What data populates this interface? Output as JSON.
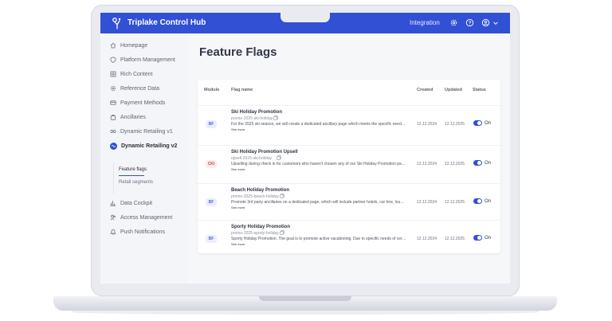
{
  "header": {
    "app_title": "Triplake Control Hub",
    "integration_label": "Integration",
    "icons": [
      "logo-icon",
      "gear-icon",
      "help-icon",
      "user-icon",
      "chevron-down-icon"
    ],
    "brand_color": "#3150d4"
  },
  "sidebar": {
    "items": [
      {
        "label": "Homepage",
        "icon": "home-icon"
      },
      {
        "label": "Platform Management",
        "icon": "shield-icon"
      },
      {
        "label": "Rich Content",
        "icon": "grid-icon"
      },
      {
        "label": "Reference Data",
        "icon": "settings-icon"
      },
      {
        "label": "Payment Methods",
        "icon": "credit-card-icon"
      },
      {
        "label": "Ancillaries",
        "icon": "bag-icon"
      },
      {
        "label": "Dynamic Retailing v1",
        "icon": "loop-icon"
      },
      {
        "label": "Dynamic Retailing v2",
        "icon": "active-dot-icon"
      },
      {
        "label": "Data Cockpit",
        "icon": "bar-chart-icon"
      },
      {
        "label": "Access Management",
        "icon": "users-icon"
      },
      {
        "label": "Push Notifications",
        "icon": "bell-icon"
      }
    ],
    "subitems": [
      {
        "label": "Feature flags"
      },
      {
        "label": "Retail segments"
      }
    ]
  },
  "main": {
    "page_title": "Feature Flags",
    "table": {
      "headers": {
        "module": "Module",
        "flag_name": "Flag name",
        "created": "Created",
        "updated": "Updated",
        "status": "Status"
      },
      "rows": [
        {
          "module": "BF",
          "name": "Ski Holiday Promotion",
          "key": "promo-2025-ski-holiday",
          "description": "For the 2025 ski season, we will create a dedicated ancillary page which meets the specific needs of s...",
          "see_more": "See more",
          "created": "12.12.2024",
          "updated": "12.12.2025",
          "status": "On"
        },
        {
          "module": "CKI",
          "name": "Ski Holiday Promotion Upsell",
          "key": "upsell-2025-ski-holiday",
          "description": "Upselling during check in for customers who haven't chosen any of our Ski Holiday Promotion packa...",
          "see_more": "See more",
          "created": "12.12.2024",
          "updated": "12.12.2025",
          "status": "On"
        },
        {
          "module": "BF",
          "name": "Beach Holiday Promotion",
          "key": "promo-2025-beach-holiday",
          "description": "Promote 3rd party ancillaries on a dedicated page, which will include partner hotels, car hire, loungs...",
          "see_more": "See more",
          "created": "12.12.2024",
          "updated": "12.12.2025",
          "status": "On"
        },
        {
          "module": "BF",
          "name": "Sporty Holiday Promotion",
          "key": "promo-2025-sporty-holiday",
          "description": "Sporty Holiday Promotion. The goal is to promote active vacationing. Due to specific needs of cert...",
          "see_more": "See more",
          "created": "12.12.2024",
          "updated": "12.12.2025",
          "status": "On"
        }
      ]
    }
  }
}
